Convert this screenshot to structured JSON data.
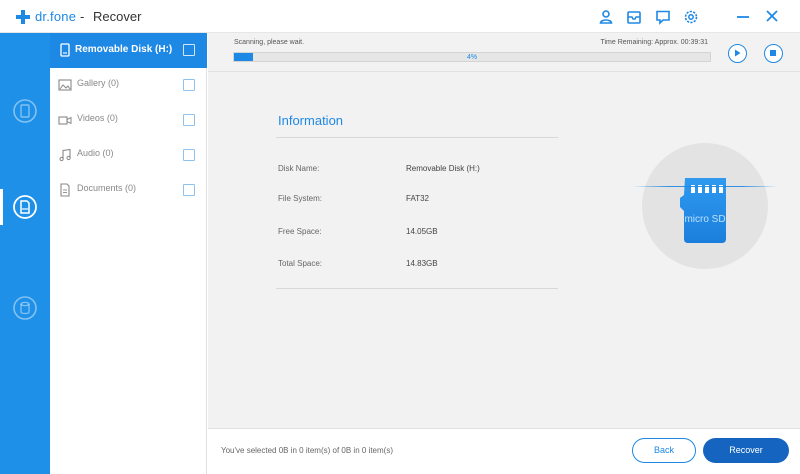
{
  "window": {
    "brand": "dr.fone",
    "separator": "-",
    "title": "Recover",
    "icons": [
      "user-icon",
      "mail-icon",
      "chat-icon",
      "settings-icon"
    ],
    "controls": [
      "minimize-icon",
      "close-icon"
    ]
  },
  "rail": {
    "items": [
      {
        "name": "recover-device-icon",
        "active": false
      },
      {
        "name": "recover-sd-card-icon",
        "active": true
      },
      {
        "name": "recover-backup-icon",
        "active": false
      }
    ]
  },
  "categories": [
    {
      "label": "Removable Disk (H:)",
      "icon": "disk-icon",
      "active": true
    },
    {
      "label": "Gallery (0)",
      "icon": "image-icon",
      "active": false
    },
    {
      "label": "Videos (0)",
      "icon": "video-icon",
      "active": false
    },
    {
      "label": "Audio (0)",
      "icon": "music-note-icon",
      "active": false
    },
    {
      "label": "Documents (0)",
      "icon": "document-icon",
      "active": false
    }
  ],
  "scan": {
    "status": "Scanning, please wait.",
    "time_remaining": "Time Remaining: Approx. 00:39:31",
    "progress_percent": 4,
    "progress_label": "4%"
  },
  "info": {
    "title": "Information",
    "rows": [
      {
        "label": "Disk Name:",
        "value": "Removable Disk (H:)"
      },
      {
        "label": "File System:",
        "value": "FAT32"
      },
      {
        "label": "Free Space:",
        "value": "14.05GB"
      },
      {
        "label": "Total Space:",
        "value": "14.83GB"
      }
    ]
  },
  "card_graphic": {
    "text": "micro SD"
  },
  "footer": {
    "selection": "You've selected 0B in 0 item(s) of 0B in 0 item(s)",
    "back_label": "Back",
    "recover_label": "Recover"
  },
  "colors": {
    "accent": "#1e88e5",
    "rail": "#1e90e8",
    "recover_button": "#1565c0",
    "main_bg": "#f2f2f2"
  }
}
